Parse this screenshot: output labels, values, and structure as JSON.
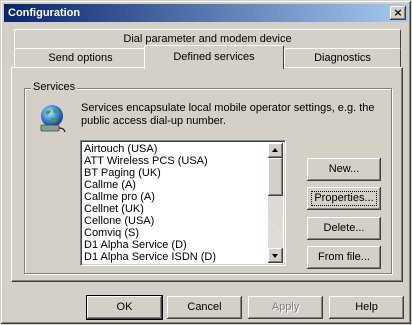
{
  "window": {
    "title": "Configuration",
    "close_glyph": "×"
  },
  "tabs": {
    "row1": [
      {
        "label": "Dial parameter and modem device"
      }
    ],
    "row2": [
      {
        "label": "Send options"
      },
      {
        "label": "Defined services",
        "selected": true
      },
      {
        "label": "Diagnostics"
      }
    ]
  },
  "services": {
    "group_label": "Services",
    "icon": "globe-network-icon",
    "description": "Services encapsulate local mobile operator settings, e.g. the public access dial-up number.",
    "items": [
      "Airtouch (USA)",
      "ATT Wireless PCS (USA)",
      "BT Paging (UK)",
      "Callme (A)",
      "Callme pro (A)",
      "Cellnet (UK)",
      "Cellone (USA)",
      "Comviq (S)",
      "D1 Alpha Service (D)",
      "D1 Alpha Service ISDN (D)"
    ],
    "buttons": {
      "new": "New...",
      "properties": "Properties...",
      "delete": "Delete...",
      "from_file": "From file..."
    }
  },
  "footer": {
    "ok": "OK",
    "cancel": "Cancel",
    "apply": "Apply",
    "help": "Help"
  },
  "colors": {
    "title_start": "#0a246a",
    "title_end": "#a6caf0",
    "face": "#d4d0c8"
  }
}
